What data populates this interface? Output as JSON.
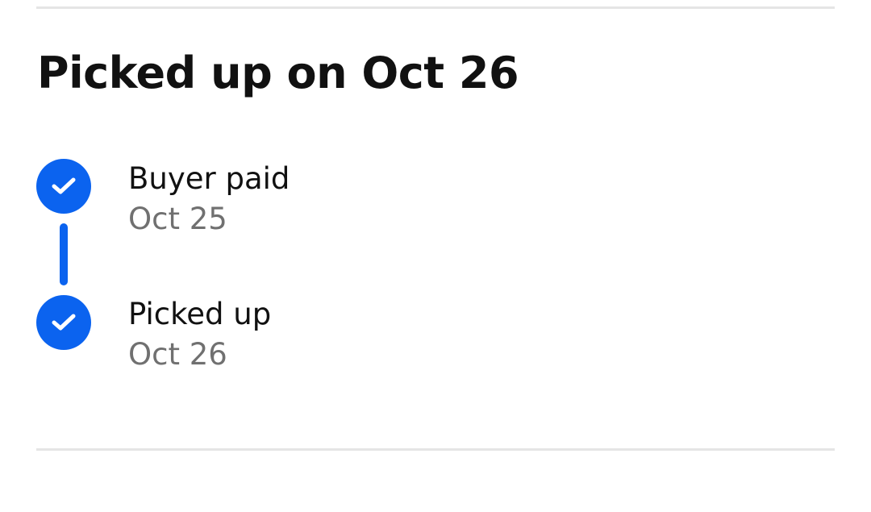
{
  "title": "Picked up on Oct 26",
  "accent_color": "#0b63ef",
  "steps": [
    {
      "label": "Buyer paid",
      "date": "Oct 25",
      "icon": "check-circle-icon",
      "completed": true
    },
    {
      "label": "Picked up",
      "date": "Oct 26",
      "icon": "check-circle-icon",
      "completed": true
    }
  ]
}
